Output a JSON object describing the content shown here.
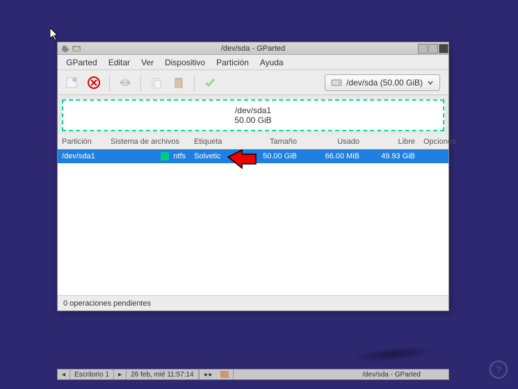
{
  "titlebar": {
    "title": "/dev/sda - GParted"
  },
  "menu": {
    "gparted": "GParted",
    "editar": "Editar",
    "ver": "Ver",
    "dispositivo": "Dispositivo",
    "particion": "Partición",
    "ayuda": "Ayuda"
  },
  "device_selector": {
    "label": "/dev/sda (50.00 GiB)"
  },
  "disk_graphic": {
    "name": "/dev/sda1",
    "size": "50.00 GiB"
  },
  "columns": {
    "particion": "Partición",
    "sistema": "Sistema de archivos",
    "etiqueta": "Etiqueta",
    "tamano": "Tamaño",
    "usado": "Usado",
    "libre": "Libre",
    "opciones": "Opciones"
  },
  "rows": [
    {
      "particion": "/dev/sda1",
      "fs": "ntfs",
      "etiqueta": "Solvetic",
      "tamano": "50.00 GiB",
      "usado": "66.00 MiB",
      "libre": "49.93 GiB",
      "opciones": ""
    }
  ],
  "status": {
    "pending": "0 operaciones pendientes"
  },
  "taskbar": {
    "desktop": "Escritorio 1",
    "datetime": "26 feb, mié 11:57:14",
    "active": "/dev/sda - GParted"
  }
}
